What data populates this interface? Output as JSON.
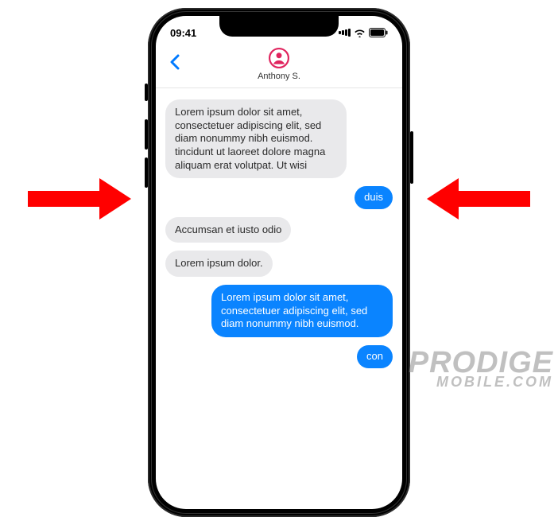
{
  "status": {
    "time": "09:41"
  },
  "header": {
    "contact_name": "Anthony S."
  },
  "messages": [
    {
      "direction": "incoming",
      "text": "Lorem ipsum dolor sit amet, consectetuer adipiscing elit, sed diam nonummy nibh euismod. tincidunt ut laoreet dolore magna aliquam erat volutpat. Ut wisi"
    },
    {
      "direction": "outgoing",
      "text": "duis"
    },
    {
      "direction": "incoming",
      "text": "Accumsan et iusto odio"
    },
    {
      "direction": "incoming",
      "text": "Lorem ipsum dolor."
    },
    {
      "direction": "outgoing",
      "text": "Lorem ipsum dolor sit amet, consectetuer adipiscing elit, sed diam nonummy nibh euismod."
    },
    {
      "direction": "outgoing",
      "text": "con"
    }
  ],
  "watermark": {
    "line1": "PRODIGE",
    "line2": "MOBILE.COM"
  }
}
